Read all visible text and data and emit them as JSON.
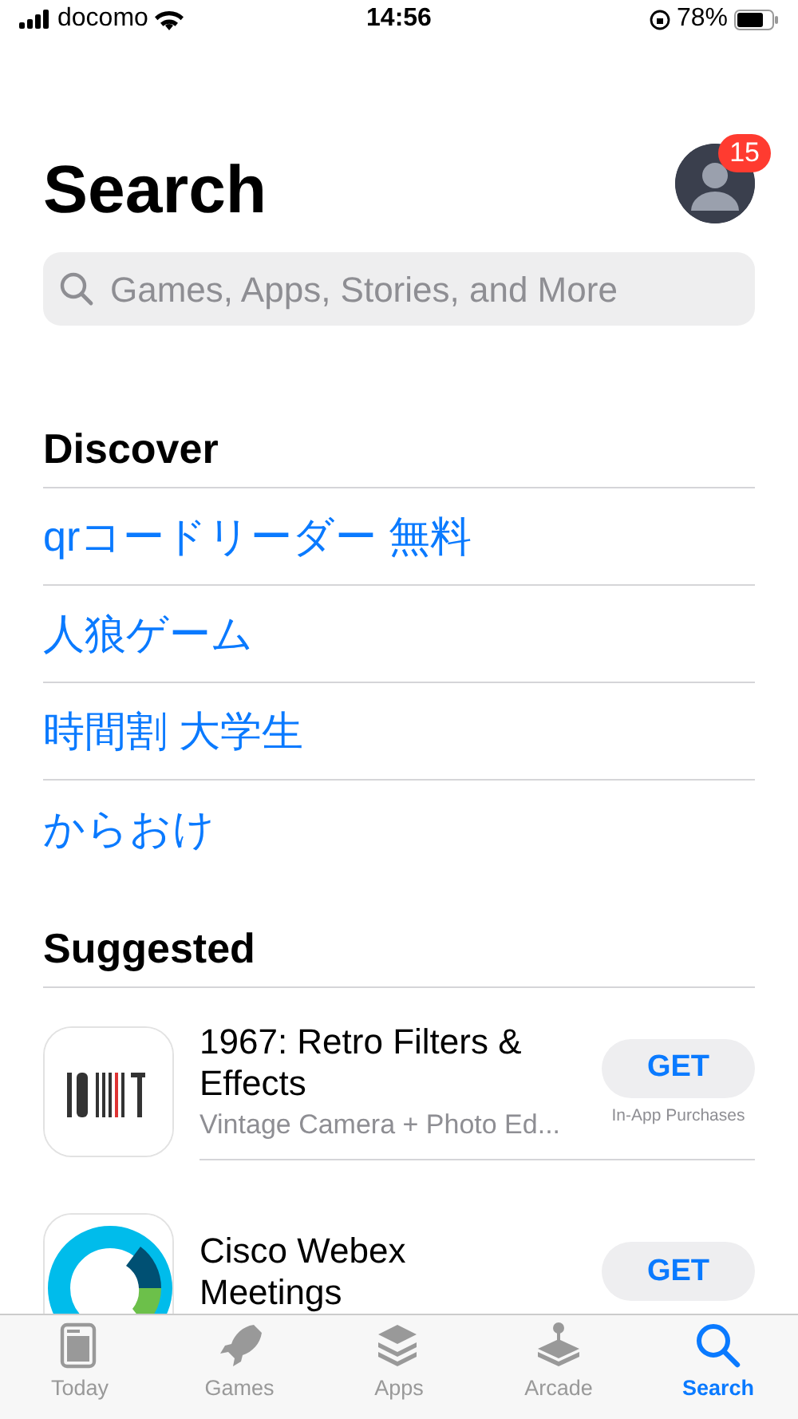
{
  "status_bar": {
    "carrier": "docomo",
    "time": "14:56",
    "battery": "78%"
  },
  "title": "Search",
  "account": {
    "badge": "15"
  },
  "search": {
    "placeholder": "Games, Apps, Stories, and More"
  },
  "discover": {
    "heading": "Discover",
    "items": [
      "qrコードリーダー 無料",
      "人狼ゲーム",
      "時間割 大学生",
      "からおけ"
    ]
  },
  "suggested": {
    "heading": "Suggested",
    "apps": [
      {
        "kind": "retro",
        "name": "1967: Retro Filters & Effects",
        "subtitle": "Vintage Camera + Photo Ed...",
        "button": "GET",
        "note": "In-App Purchases"
      },
      {
        "kind": "webex",
        "name": "Cisco Webex Meetings",
        "button": "GET"
      }
    ]
  },
  "tabs": [
    {
      "label": "Today",
      "selected": false
    },
    {
      "label": "Games",
      "selected": false
    },
    {
      "label": "Apps",
      "selected": false
    },
    {
      "label": "Arcade",
      "selected": false
    },
    {
      "label": "Search",
      "selected": true
    }
  ]
}
